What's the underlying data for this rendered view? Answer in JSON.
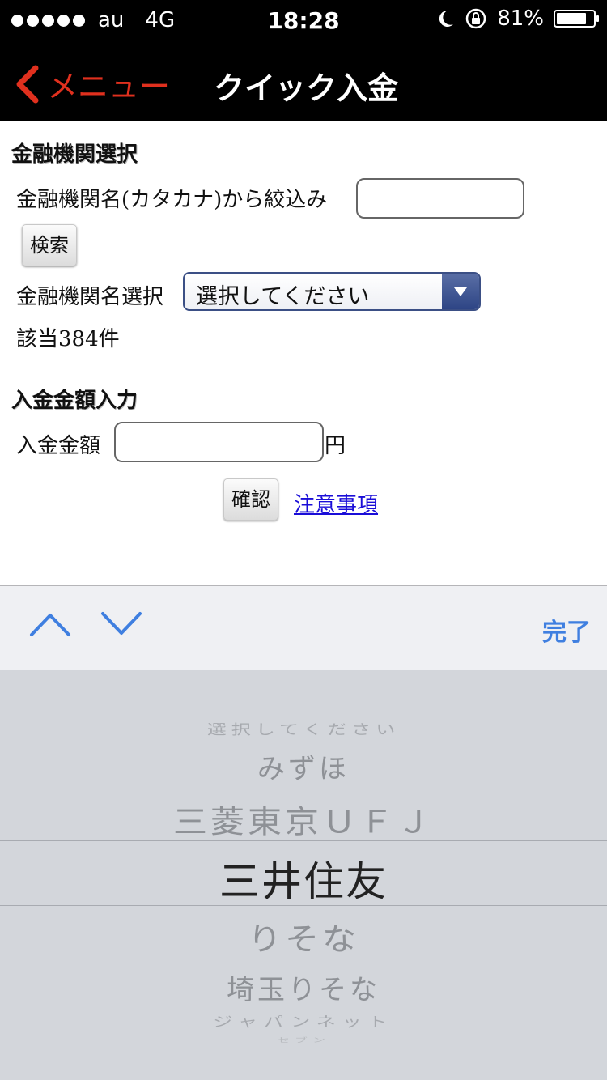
{
  "status_bar": {
    "carrier": "au",
    "network": "4G",
    "time": "18:28",
    "battery": "81%",
    "battery_level": 0.81
  },
  "nav": {
    "back_label": "メニュー",
    "title": "クイック入金"
  },
  "bank_section": {
    "title": "金融機関選択",
    "filter_label": "金融機関名(カタカナ)から絞込み",
    "filter_value": "",
    "search_button": "検索",
    "select_label": "金融機関名選択",
    "select_value": "選択してください",
    "result_count": "該当384件"
  },
  "amount_section": {
    "title": "入金金額入力",
    "amount_label": "入金金額",
    "amount_value": "",
    "unit": "円",
    "confirm_button": "確認",
    "notice_link": "注意事項"
  },
  "toolbar": {
    "done_label": "完了"
  },
  "picker": {
    "options": [
      "選択してください",
      "みずほ",
      "三菱東京ＵＦＪ",
      "三井住友",
      "りそな",
      "埼玉りそな",
      "ジャパンネット",
      "セブン"
    ],
    "selected": "三井住友"
  },
  "colors": {
    "back_accent": "#e0301e",
    "done_accent": "#3f7fe0",
    "link": "#1a0dd8",
    "select_arrow": "#2e4585"
  }
}
